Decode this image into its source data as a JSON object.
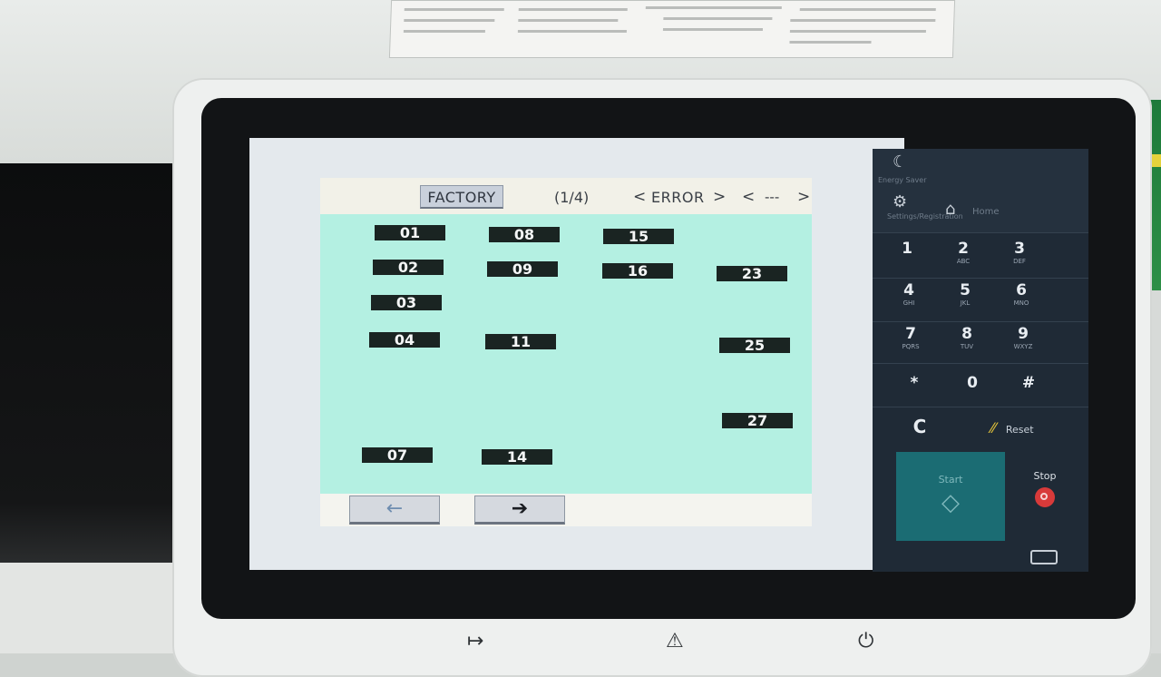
{
  "header": {
    "factory_label": "FACTORY",
    "page_indicator": "(1/4)",
    "mode_label": "ERROR",
    "subcode_label": "---",
    "prev_glyph": "<",
    "next_glyph": ">"
  },
  "codes": [
    "01",
    "02",
    "03",
    "04",
    "07",
    "08",
    "09",
    "11",
    "14",
    "15",
    "16",
    "23",
    "25",
    "27"
  ],
  "footer": {
    "back_arrow_icon": "left-arrow",
    "forward_arrow_icon": "right-arrow"
  },
  "keypad": {
    "energy_saver_label": "Energy Saver",
    "settings_label": "Settings/Registration",
    "home_label": "Home",
    "keys": [
      {
        "digit": "1",
        "letters": ""
      },
      {
        "digit": "2",
        "letters": "ABC"
      },
      {
        "digit": "3",
        "letters": "DEF"
      },
      {
        "digit": "4",
        "letters": "GHI"
      },
      {
        "digit": "5",
        "letters": "JKL"
      },
      {
        "digit": "6",
        "letters": "MNO"
      },
      {
        "digit": "7",
        "letters": "PQRS"
      },
      {
        "digit": "8",
        "letters": "TUV"
      },
      {
        "digit": "9",
        "letters": "WXYZ"
      },
      {
        "digit": "*",
        "letters": ""
      },
      {
        "digit": "0",
        "letters": ""
      },
      {
        "digit": "#",
        "letters": ""
      }
    ],
    "clear_label": "C",
    "reset_label": "Reset",
    "start_label": "Start",
    "stop_label": "Stop"
  },
  "colors": {
    "content_bg": "#b4f0e2",
    "code_button_bg": "#1a2422",
    "keypad_bg": "#1f2a36",
    "start_bg": "#1b6c73",
    "stop_red": "#d83a3a"
  }
}
